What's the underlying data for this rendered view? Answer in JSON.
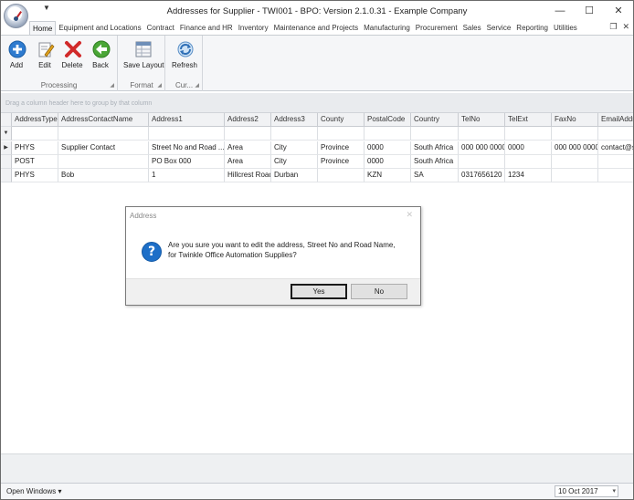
{
  "window": {
    "title": "Addresses for Supplier - TWI001 - BPO: Version 2.1.0.31 - Example Company",
    "qat_arrow": "▼",
    "min_glyph": "—",
    "max_glyph": "☐",
    "close_glyph": "✕"
  },
  "tabs": [
    "Home",
    "Equipment and Locations",
    "Contract",
    "Finance and HR",
    "Inventory",
    "Maintenance and Projects",
    "Manufacturing",
    "Procurement",
    "Sales",
    "Service",
    "Reporting",
    "Utilities"
  ],
  "mdi": {
    "restore": "❐",
    "close": "✕"
  },
  "ribbon": {
    "groups": {
      "processing": "Processing",
      "format": "Format",
      "current": "Cur..."
    },
    "buttons": {
      "add": "Add",
      "edit": "Edit",
      "delete": "Delete",
      "back": "Back",
      "save_layout": "Save Layout",
      "refresh": "Refresh"
    },
    "icons": [
      "add-icon",
      "edit-icon",
      "delete-icon",
      "back-icon",
      "save-layout-icon",
      "refresh-icon"
    ]
  },
  "groupby_hint": "Drag a column header here to group by that column",
  "grid": {
    "columns": [
      "AddressType",
      "AddressContactName",
      "Address1",
      "Address2",
      "Address3",
      "County",
      "PostalCode",
      "Country",
      "TelNo",
      "TelExt",
      "FaxNo",
      "EmailAddress"
    ],
    "filter_glyph": "▼",
    "row_indicator": "▶",
    "rows": [
      [
        "PHYS",
        "Supplier Contact",
        "Street No and Road ...",
        "Area",
        "City",
        "Province",
        "0000",
        "South Africa",
        "000 000 0000",
        "0000",
        "000 000 0000",
        "contact@s"
      ],
      [
        "POST",
        "",
        "PO Box 000",
        "Area",
        "City",
        "Province",
        "0000",
        "South Africa",
        "",
        "",
        "",
        ""
      ],
      [
        "PHYS",
        "Bob",
        "1",
        "Hillcrest Road",
        "Durban",
        "",
        "KZN",
        "SA",
        "0317656120",
        "1234",
        "",
        ""
      ]
    ]
  },
  "status": {
    "open_windows": "Open Windows ▾",
    "date": "10 Oct 2017",
    "date_dropdown": "▾"
  },
  "dialog": {
    "title": "Address",
    "close_glyph": "✕",
    "info_glyph": "?",
    "message_line1": "Are you sure you want to edit the address, Street No and Road Name,",
    "message_line2": "for Twinkle Office Automation Supplies?",
    "yes_label": "Yes",
    "no_label": "No"
  }
}
